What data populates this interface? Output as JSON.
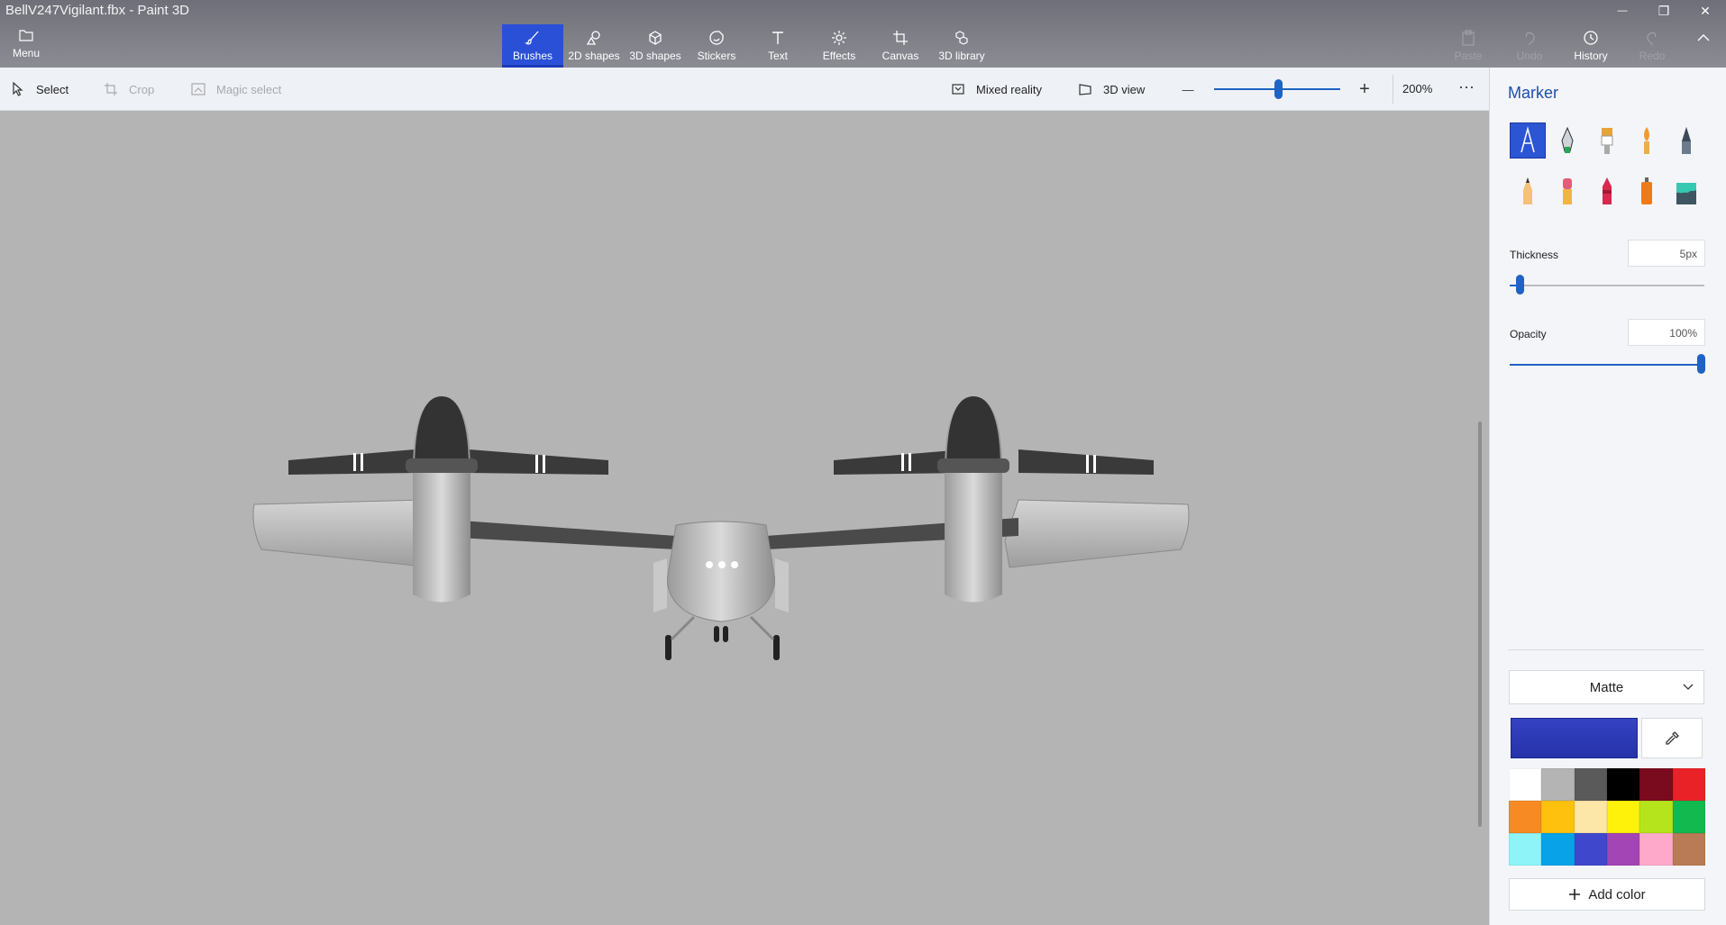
{
  "window": {
    "title": "BellV247Vigilant.fbx - Paint 3D",
    "minimize_glyph": "—",
    "restore_glyph": "❐",
    "close_glyph": "✕"
  },
  "menu": {
    "label": "Menu"
  },
  "tools": [
    {
      "label": "Brushes",
      "icon": "brush-icon",
      "active": true
    },
    {
      "label": "2D shapes",
      "icon": "2d-shapes-icon"
    },
    {
      "label": "3D shapes",
      "icon": "3d-shapes-icon"
    },
    {
      "label": "Stickers",
      "icon": "stickers-icon"
    },
    {
      "label": "Text",
      "icon": "text-icon"
    },
    {
      "label": "Effects",
      "icon": "effects-icon"
    },
    {
      "label": "Canvas",
      "icon": "canvas-icon"
    },
    {
      "label": "3D library",
      "icon": "3d-library-icon"
    }
  ],
  "right_tools": [
    {
      "label": "Paste",
      "icon": "paste-icon",
      "enabled": false
    },
    {
      "label": "Undo",
      "icon": "undo-icon",
      "enabled": false
    },
    {
      "label": "History",
      "icon": "history-icon",
      "enabled": true
    },
    {
      "label": "Redo",
      "icon": "redo-icon",
      "enabled": false
    }
  ],
  "subbar": {
    "select": "Select",
    "crop": "Crop",
    "magic_select": "Magic select",
    "mixed_reality": "Mixed reality",
    "view_3d": "3D view",
    "zoom_out_glyph": "—",
    "zoom_in_glyph": "+",
    "zoom_level": "200%",
    "zoom_fraction": 0.54,
    "more_glyph": "···"
  },
  "panel": {
    "title": "Marker",
    "brushes": [
      {
        "name": "marker",
        "active": true
      },
      {
        "name": "calligraphy-pen"
      },
      {
        "name": "oil-brush"
      },
      {
        "name": "watercolor"
      },
      {
        "name": "pixel-pen"
      },
      {
        "name": "pencil"
      },
      {
        "name": "eraser"
      },
      {
        "name": "crayon"
      },
      {
        "name": "spray-can"
      },
      {
        "name": "fill-bucket"
      }
    ],
    "thickness_label": "Thickness",
    "thickness_value": "5px",
    "thickness_fraction": 0.05,
    "opacity_label": "Opacity",
    "opacity_value": "100%",
    "opacity_fraction": 1.0,
    "finish": "Matte",
    "current_color": "#3442c4",
    "palette": [
      "#ffffff",
      "#b4b4b4",
      "#5a5a5a",
      "#000000",
      "#7a0a1e",
      "#e82227",
      "#f78a22",
      "#fec20e",
      "#fde7a8",
      "#fef10a",
      "#b6e41c",
      "#11b94e",
      "#8ef4f7",
      "#08a2e8",
      "#3f48cc",
      "#a345b5",
      "#fea9c9",
      "#b97b56"
    ],
    "add_color": "Add color"
  }
}
